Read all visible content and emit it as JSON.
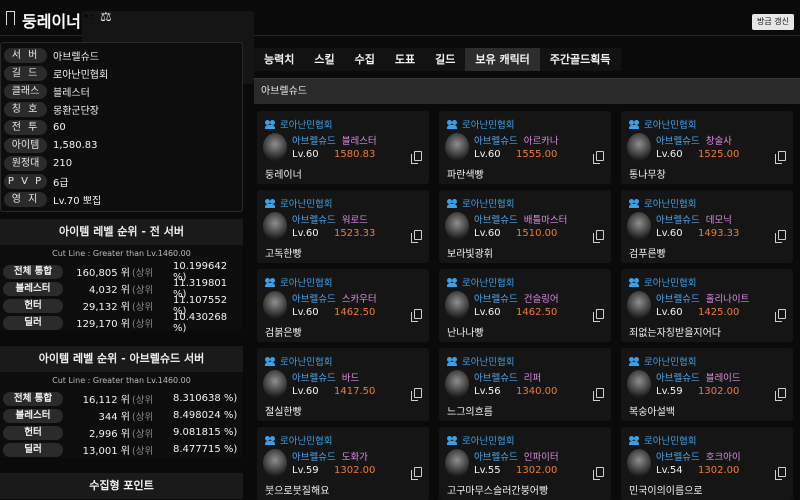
{
  "header": {
    "character_name": "둥레이너",
    "refresh_label": "방금 갱신",
    "icons": [
      "bookmark-icon",
      "card-icon",
      "scale-icon"
    ]
  },
  "profile": {
    "rows": [
      {
        "label": "서 버",
        "value": "아브렐슈드"
      },
      {
        "label": "길 드",
        "value": "로아난민협회"
      },
      {
        "label": "클래스",
        "value": "블레스터"
      },
      {
        "label": "칭 호",
        "value": "몽환군단장"
      },
      {
        "label": "전 투",
        "value": "60"
      },
      {
        "label": "아이템",
        "value": "1,580.83"
      },
      {
        "label": "원정대",
        "value": "210"
      },
      {
        "label": "P V P",
        "value": "6급"
      },
      {
        "label": "영 지",
        "value": "Lv.70 뽀집"
      }
    ]
  },
  "ranking_all": {
    "title": "아이템 레벨 순위 - 전 서버",
    "cutline": "Cut Line : Greater than Lv.1460.00",
    "rows": [
      {
        "label": "전체 통합",
        "rank": "160,805 위",
        "suffix": "(상위",
        "pct": "10.199642 %)"
      },
      {
        "label": "블레스터",
        "rank": "4,032 위",
        "suffix": "(상위",
        "pct": "11.319801 %)"
      },
      {
        "label": "헌터",
        "rank": "29,132 위",
        "suffix": "(상위",
        "pct": "11.107552 %)"
      },
      {
        "label": "딜러",
        "rank": "129,170 위",
        "suffix": "(상위",
        "pct": "10.430268 %)"
      }
    ]
  },
  "ranking_server": {
    "title": "아이템 레벨 순위 - 아브렐슈드 서버",
    "cutline": "Cut Line : Greater than Lv.1460.00",
    "rows": [
      {
        "label": "전체 통합",
        "rank": "16,112 위",
        "suffix": "(상위",
        "pct": "8.310638 %)"
      },
      {
        "label": "블레스터",
        "rank": "344 위",
        "suffix": "(상위",
        "pct": "8.498024 %)"
      },
      {
        "label": "헌터",
        "rank": "2,996 위",
        "suffix": "(상위",
        "pct": "9.081815 %)"
      },
      {
        "label": "딜러",
        "rank": "13,001 위",
        "suffix": "(상위",
        "pct": "8.477715 %)"
      }
    ]
  },
  "collect_section": {
    "title": "수집형 포인트"
  },
  "tabs": [
    "능력치",
    "스킬",
    "수집",
    "도표",
    "길드",
    "보유 캐릭터",
    "주간골드획득"
  ],
  "active_tab": "보유 캐릭터",
  "server_bar": "아브렐슈드",
  "characters": [
    {
      "guild": "로아난민협회",
      "server": "아브렐슈드",
      "class": "블레스터",
      "lv": "Lv.60",
      "ilv": "1580.83",
      "name": "둥레이너"
    },
    {
      "guild": "로아난민협회",
      "server": "아브렐슈드",
      "class": "아르카나",
      "lv": "Lv.60",
      "ilv": "1555.00",
      "name": "파란색빵"
    },
    {
      "guild": "로아난민협회",
      "server": "아브렐슈드",
      "class": "창술사",
      "lv": "Lv.60",
      "ilv": "1525.00",
      "name": "통나무창"
    },
    {
      "guild": "로아난민협회",
      "server": "아브렐슈드",
      "class": "워로드",
      "lv": "Lv.60",
      "ilv": "1523.33",
      "name": "고독한빵"
    },
    {
      "guild": "로아난민협회",
      "server": "아브렐슈드",
      "class": "배틀마스터",
      "lv": "Lv.60",
      "ilv": "1510.00",
      "name": "보라빛광휘"
    },
    {
      "guild": "로아난민협회",
      "server": "아브렐슈드",
      "class": "데모닉",
      "lv": "Lv.60",
      "ilv": "1493.33",
      "name": "검푸른빵"
    },
    {
      "guild": "로아난민협회",
      "server": "아브렐슈드",
      "class": "스카우터",
      "lv": "Lv.60",
      "ilv": "1462.50",
      "name": "검붉은빵"
    },
    {
      "guild": "로아난민협회",
      "server": "아브렐슈드",
      "class": "건슬링어",
      "lv": "Lv.60",
      "ilv": "1462.50",
      "name": "난나나빵"
    },
    {
      "guild": "로아난민협회",
      "server": "아브렐슈드",
      "class": "홀리나이트",
      "lv": "Lv.60",
      "ilv": "1425.00",
      "name": "죄없는자칭받을지어다"
    },
    {
      "guild": "로아난민협회",
      "server": "아브렐슈드",
      "class": "바드",
      "lv": "Lv.60",
      "ilv": "1417.50",
      "name": "절실한빵"
    },
    {
      "guild": "로아난민협회",
      "server": "아브렐슈드",
      "class": "리퍼",
      "lv": "Lv.56",
      "ilv": "1340.00",
      "name": "느그의흐름"
    },
    {
      "guild": "로아난민협회",
      "server": "아브렐슈드",
      "class": "블레이드",
      "lv": "Lv.59",
      "ilv": "1302.00",
      "name": "복숭아설백"
    },
    {
      "guild": "로아난민협회",
      "server": "아브렐슈드",
      "class": "도화가",
      "lv": "Lv.59",
      "ilv": "1302.00",
      "name": "붓으로붓질해요"
    },
    {
      "guild": "로아난민협회",
      "server": "아브렐슈드",
      "class": "인파이터",
      "lv": "Lv.55",
      "ilv": "1302.00",
      "name": "고구마무스슬러간붕어빵"
    },
    {
      "guild": "로아난민협회",
      "server": "아브렐슈드",
      "class": "호크아이",
      "lv": "Lv.54",
      "ilv": "1302.00",
      "name": "민국이의이름으로"
    }
  ]
}
